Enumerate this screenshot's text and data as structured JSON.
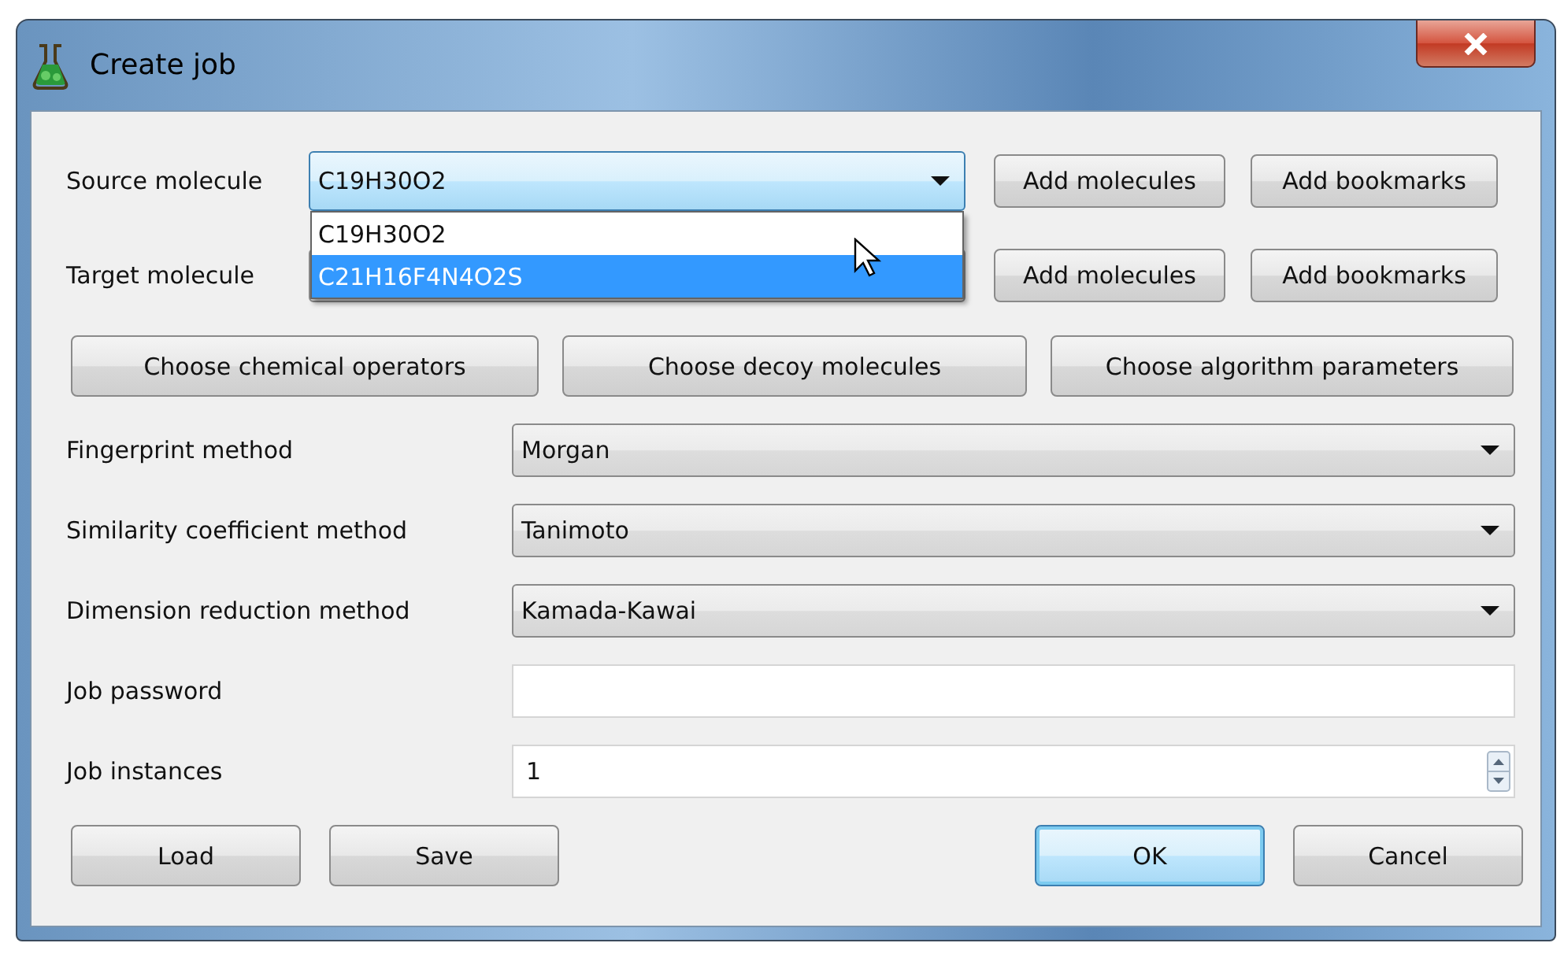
{
  "window": {
    "title": "Create job"
  },
  "source": {
    "label": "Source molecule",
    "value": "C19H30O2",
    "open": true,
    "options": [
      {
        "text": "C19H30O2",
        "highlighted": false
      },
      {
        "text": "C21H16F4N4O2S",
        "highlighted": true
      }
    ],
    "buttons": [
      "Add molecules",
      "Add bookmarks"
    ]
  },
  "target": {
    "label": "Target molecule",
    "buttons": [
      "Add molecules",
      "Add bookmarks"
    ]
  },
  "choose_buttons": [
    "Choose chemical operators",
    "Choose decoy molecules",
    "Choose algorithm parameters"
  ],
  "fields": [
    {
      "kind": "combo",
      "label": "Fingerprint method",
      "value": "Morgan"
    },
    {
      "kind": "combo",
      "label": "Similarity coefficient method",
      "value": "Tanimoto"
    },
    {
      "kind": "combo",
      "label": "Dimension reduction method",
      "value": "Kamada-Kawai"
    },
    {
      "kind": "password",
      "label": "Job password"
    },
    {
      "kind": "spin",
      "label": "Job instances",
      "value": "1"
    }
  ],
  "footer": {
    "left": [
      "Load",
      "Save"
    ],
    "right": [
      {
        "label": "OK",
        "default": true
      },
      {
        "label": "Cancel",
        "default": false
      }
    ]
  }
}
